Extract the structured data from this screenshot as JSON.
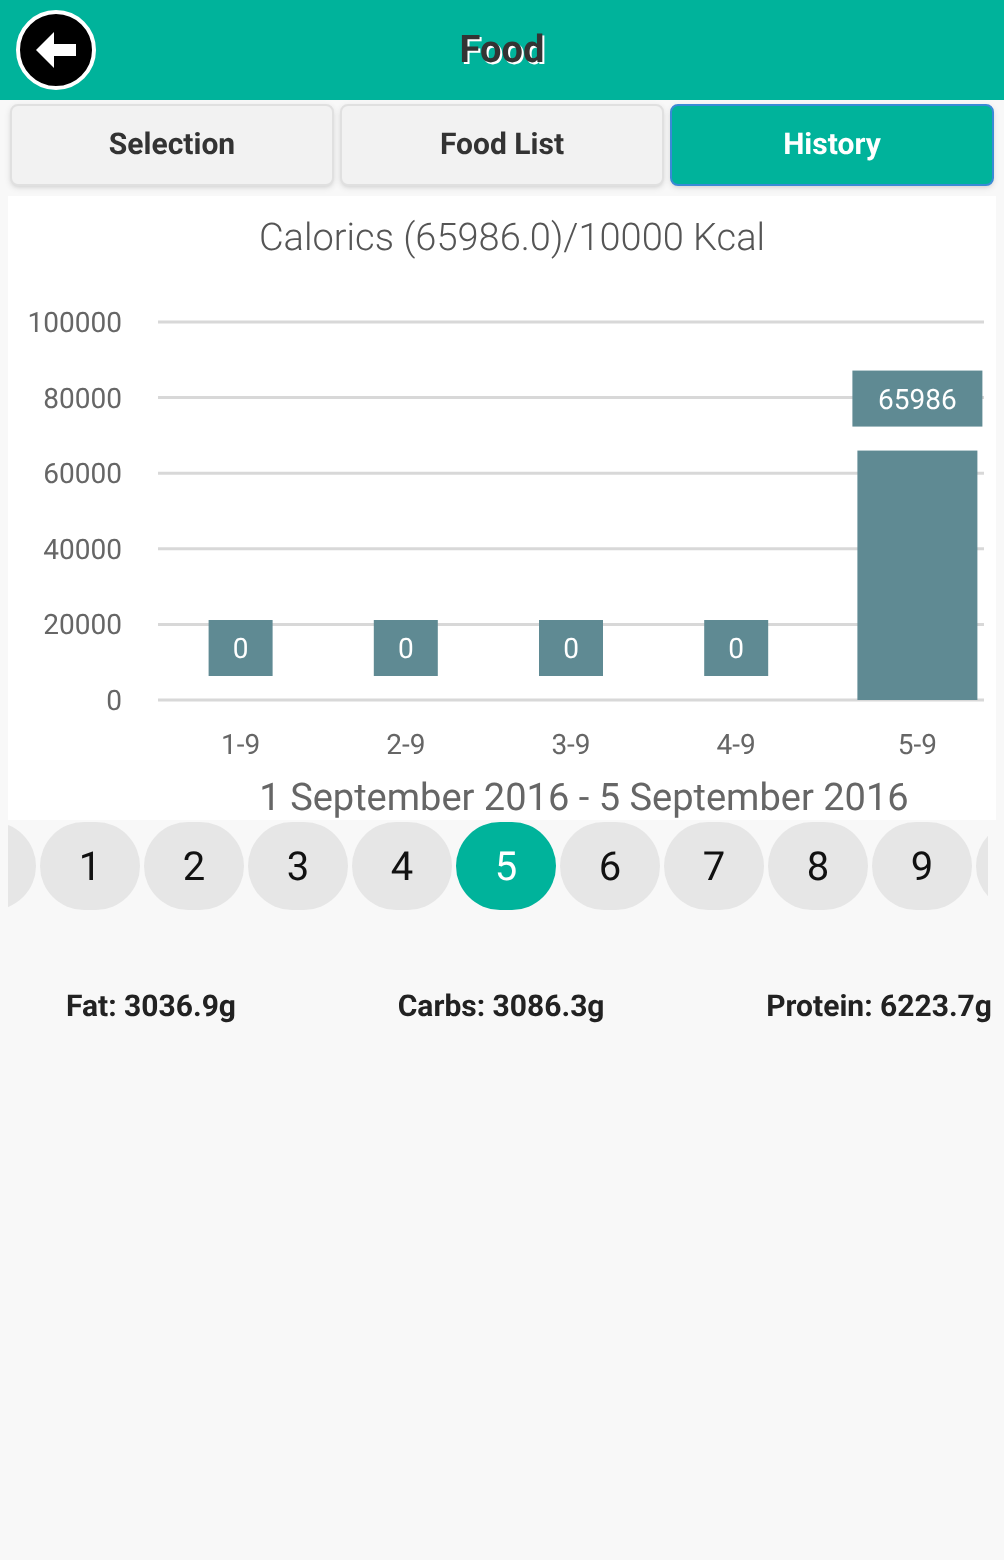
{
  "header": {
    "title": "Food"
  },
  "tabs": [
    {
      "label": "Selection",
      "selected": false
    },
    {
      "label": "Food List",
      "selected": false
    },
    {
      "label": "History",
      "selected": true
    }
  ],
  "chart": {
    "chart_data": {
      "type": "bar",
      "title": "Calorics (65986.0)/10000 Kcal",
      "xlabel": "1 September 2016 - 5 September 2016",
      "categories": [
        "1-9",
        "2-9",
        "3-9",
        "4-9",
        "5-9"
      ],
      "grid": true,
      "series": [
        {
          "color": "#5f8a93",
          "values": [
            0,
            0,
            0,
            0,
            65986
          ]
        }
      ],
      "ylim": [
        0,
        100000
      ],
      "yticks": [
        0,
        20000,
        40000,
        60000,
        80000,
        100000
      ],
      "data_labels": true
    }
  },
  "pager": [
    {
      "label": "1",
      "selected": false
    },
    {
      "label": "2",
      "selected": false
    },
    {
      "label": "3",
      "selected": false
    },
    {
      "label": "4",
      "selected": false
    },
    {
      "label": "5",
      "selected": true
    },
    {
      "label": "6",
      "selected": false
    },
    {
      "label": "7",
      "selected": false
    },
    {
      "label": "8",
      "selected": false
    },
    {
      "label": "9",
      "selected": false
    }
  ],
  "totals": [
    "Fat: 3036.9g",
    "Carbs: 3086.3g",
    "Protein: 6223.7g"
  ]
}
